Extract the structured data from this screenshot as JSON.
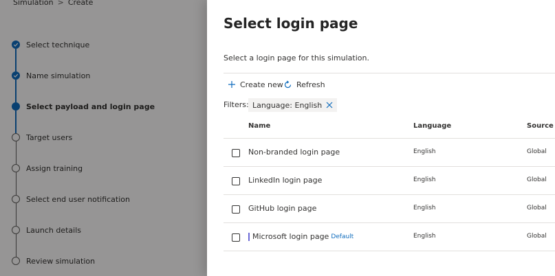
{
  "breadcrumb": {
    "root": "Simulation",
    "separator": ">",
    "current": "Create"
  },
  "steps": [
    {
      "label": "Select technique",
      "state": "done"
    },
    {
      "label": "Name simulation",
      "state": "done"
    },
    {
      "label": "Select payload and login page",
      "state": "current"
    },
    {
      "label": "Target users",
      "state": "todo"
    },
    {
      "label": "Assign training",
      "state": "todo"
    },
    {
      "label": "Select end user notification",
      "state": "todo"
    },
    {
      "label": "Launch details",
      "state": "todo"
    },
    {
      "label": "Review simulation",
      "state": "todo"
    }
  ],
  "panel": {
    "title": "Select login page",
    "description": "Select a login page for this simulation.",
    "commands": {
      "create_new": "Create new",
      "refresh": "Refresh"
    },
    "filters_label": "Filters:",
    "filter_chip": "Language: English",
    "columns": {
      "name": "Name",
      "language": "Language",
      "source": "Source"
    },
    "rows": [
      {
        "name": "Non-branded login page",
        "language": "English",
        "source": "Global",
        "badge": ""
      },
      {
        "name": "LinkedIn login page",
        "language": "English",
        "source": "Global",
        "badge": ""
      },
      {
        "name": "GitHub login page",
        "language": "English",
        "source": "Global",
        "badge": ""
      },
      {
        "name": "Microsoft login page",
        "language": "English",
        "source": "Global",
        "badge": "Default"
      }
    ]
  },
  "colors": {
    "accent": "#0f6cbd",
    "text": "#323130",
    "divider": "#e1dfdd",
    "chip_bg": "#f3f2f1"
  }
}
